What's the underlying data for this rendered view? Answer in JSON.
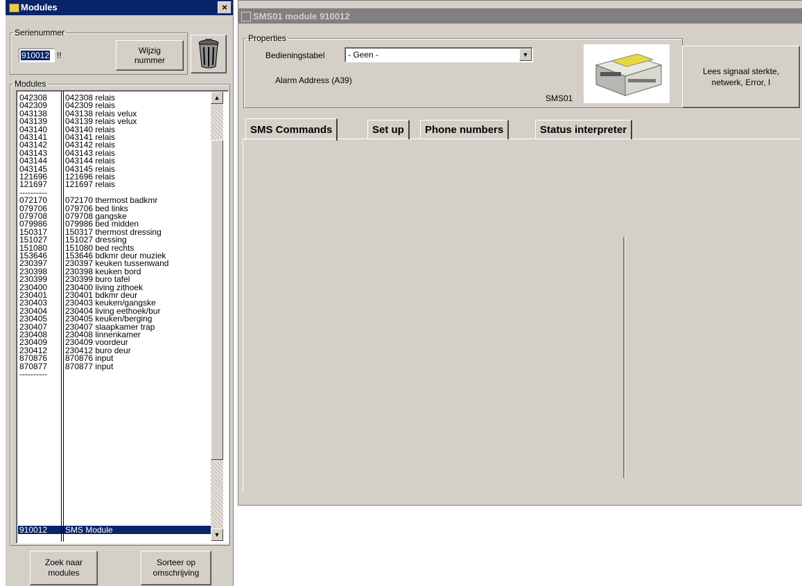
{
  "left": {
    "title": "Modules",
    "close": "×",
    "serial_legend": "Serienummer",
    "serial_value": "910012",
    "serial_flag": "!!",
    "change_button": "Wijzig\nnummer",
    "modules_legend": "Modules",
    "modules": [
      {
        "code": "042308",
        "name": "042308 relais"
      },
      {
        "code": "042309",
        "name": "042309 relais"
      },
      {
        "code": "043138",
        "name": "043138 relais velux"
      },
      {
        "code": "043139",
        "name": "043139 relais velux"
      },
      {
        "code": "043140",
        "name": "043140 relais"
      },
      {
        "code": "043141",
        "name": "043141 relais"
      },
      {
        "code": "043142",
        "name": "043142 relais"
      },
      {
        "code": "043143",
        "name": "043143 relais"
      },
      {
        "code": "043144",
        "name": "043144 relais"
      },
      {
        "code": "043145",
        "name": "043145 relais"
      },
      {
        "code": "121696",
        "name": "121696 relais"
      },
      {
        "code": "121697",
        "name": "121697 relais"
      },
      {
        "code": "----------",
        "name": ""
      },
      {
        "code": "072170",
        "name": "072170 thermost badkmr"
      },
      {
        "code": "079706",
        "name": "079706 bed links"
      },
      {
        "code": "079708",
        "name": "079708 gangske"
      },
      {
        "code": "079986",
        "name": "079986 bed midden"
      },
      {
        "code": "150317",
        "name": "150317 thermost dressing"
      },
      {
        "code": "151027",
        "name": "151027 dressing"
      },
      {
        "code": "151080",
        "name": "151080 bed rechts"
      },
      {
        "code": "153646",
        "name": "153646 bdkmr deur muziek"
      },
      {
        "code": "230397",
        "name": "230397 keuken tussenwand"
      },
      {
        "code": "230398",
        "name": "230398 keuken bord"
      },
      {
        "code": "230399",
        "name": "230399 buro tafel"
      },
      {
        "code": "230400",
        "name": "230400 living zithoek"
      },
      {
        "code": "230401",
        "name": "230401 bdkmr deur"
      },
      {
        "code": "230403",
        "name": "230403 keuken/gangske"
      },
      {
        "code": "230404",
        "name": "230404 living eethoek/bur"
      },
      {
        "code": "230405",
        "name": "230405 keuken/berging"
      },
      {
        "code": "230407",
        "name": "230407 slaapkamer trap"
      },
      {
        "code": "230408",
        "name": "230408 linnenkamer"
      },
      {
        "code": "230409",
        "name": "230409 voordeur"
      },
      {
        "code": "230412",
        "name": "230412 buro deur"
      },
      {
        "code": "870876",
        "name": "870876 input"
      },
      {
        "code": "870877",
        "name": "870877 input"
      },
      {
        "code": "----------",
        "name": ""
      },
      {
        "code": "910012",
        "name": "SMS Module",
        "selected": true
      }
    ],
    "search_button": "Zoek naar\nmodules",
    "sort_button": "Sorteer op\nomschrijving"
  },
  "right": {
    "title": "SMS01 module 910012",
    "properties_legend": "Properties",
    "bediening_label": "Bedieningstabel",
    "bediening_value": "- Geen -",
    "alarm_label": "Alarm Address (A39)",
    "device_caption": "SMS01",
    "signal_button": "Lees signaal sterkte,\nnetwerk, Error, I",
    "tabs": [
      "SMS Commands",
      "Set up",
      "Phone numbers",
      "Status interpreter"
    ]
  }
}
